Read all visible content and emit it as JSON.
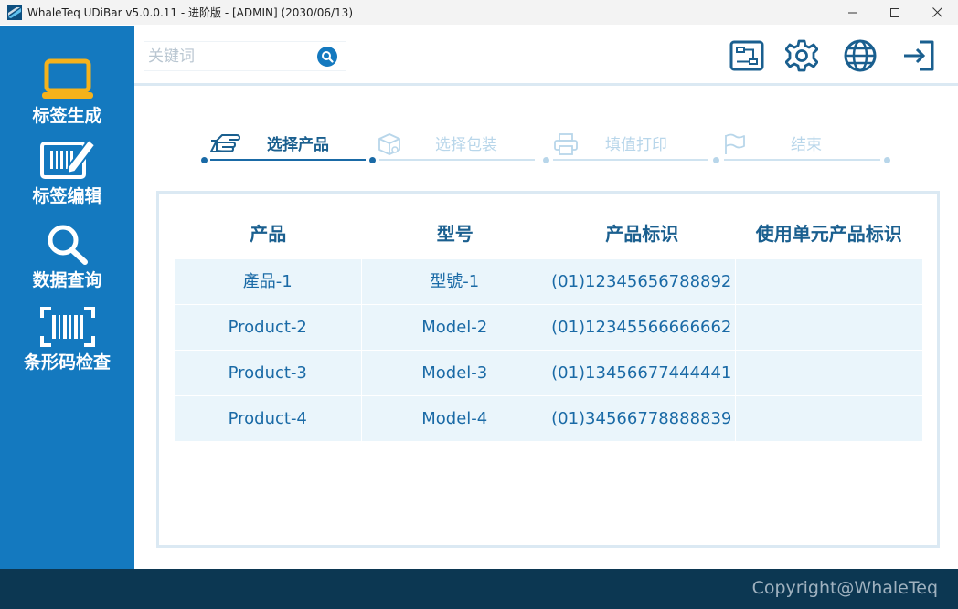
{
  "window": {
    "title": "WhaleTeq UDiBar v5.0.0.11 - 进阶版 - [ADMIN] (2030/06/13)"
  },
  "sidebar": {
    "items": [
      {
        "label": "标签生成",
        "icon": "laptop-icon",
        "active": true
      },
      {
        "label": "标签编辑",
        "icon": "barcode-edit-icon"
      },
      {
        "label": "数据查询",
        "icon": "search-icon"
      },
      {
        "label": "条形码检查",
        "icon": "barcode-scan-icon"
      }
    ]
  },
  "search": {
    "placeholder": "关键词"
  },
  "toolbar": {
    "icons": [
      "workflow-icon",
      "gear-icon",
      "globe-icon",
      "logout-icon"
    ]
  },
  "steps": [
    {
      "label": "选择产品",
      "icon": "pointing-hand-icon",
      "active": true
    },
    {
      "label": "选择包装",
      "icon": "package-icon",
      "active": false
    },
    {
      "label": "填值打印",
      "icon": "printer-icon",
      "active": false
    },
    {
      "label": "结束",
      "icon": "flag-icon",
      "active": false
    }
  ],
  "table": {
    "columns": [
      "产品",
      "型号",
      "产品标识",
      "使用单元产品标识"
    ],
    "rows": [
      [
        "產品-1",
        "型號-1",
        "(01)12345656788892",
        ""
      ],
      [
        "Product-2",
        "Model-2",
        "(01)12345566666662",
        ""
      ],
      [
        "Product-3",
        "Model-3",
        "(01)13456677444441",
        ""
      ],
      [
        "Product-4",
        "Model-4",
        "(01)34566778888839",
        ""
      ]
    ]
  },
  "footer": {
    "copyright": "Copyright@WhaleTeq"
  },
  "colors": {
    "sidebar": "#1479bf",
    "accent_yellow": "#f5b21b",
    "footer": "#0c3752",
    "active_step": "#1a5f8f",
    "inactive_step": "#b8d6ea"
  }
}
